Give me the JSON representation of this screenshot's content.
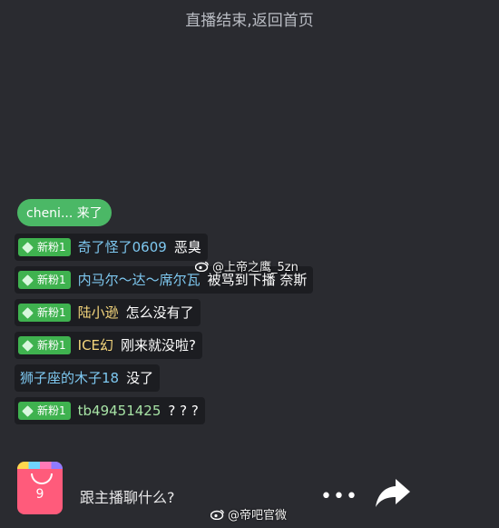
{
  "banner": {
    "text": "直播结束,返回首页"
  },
  "join_notice": {
    "text": "cheni... 来了"
  },
  "badge_label": "新粉1",
  "messages": [
    {
      "has_badge": true,
      "user": "奇了怪了0609",
      "user_color": "blue",
      "text": "恶臭"
    },
    {
      "has_badge": true,
      "user": "内马尔～达～席尔瓦",
      "user_color": "blue",
      "text": "被骂到下播 奈斯"
    },
    {
      "has_badge": true,
      "user": "陆小逊",
      "user_color": "yellow",
      "text": "怎么没有了"
    },
    {
      "has_badge": true,
      "user": "ICE幻",
      "user_color": "yellow",
      "text": "刚来就没啦?"
    },
    {
      "has_badge": false,
      "user": "狮子座的木子18",
      "user_color": "blue",
      "text": "没了"
    },
    {
      "has_badge": true,
      "user": "tb49451425",
      "user_color": "green",
      "text": "? ? ?"
    }
  ],
  "watermarks": {
    "middle": "@上帝之鹰_5zn",
    "bottom": "@帝吧官微"
  },
  "bottom_bar": {
    "gift_count": "9",
    "input_placeholder": "跟主播聊什么?",
    "more_label": "•••"
  },
  "colors": {
    "background": "#2a2b30",
    "badge_green": "#3fb24f",
    "join_pill": "#4bb866",
    "user_blue": "#7ec8f0",
    "user_yellow": "#f6d77d",
    "user_green": "#a7e3a5",
    "gift_bag": "#ff5b7b"
  },
  "icons": {
    "gift": "gift-bag-icon",
    "more": "more-dots-icon",
    "share": "share-arrow-icon",
    "watermark": "weibo-icon",
    "badge": "diamond-icon"
  }
}
